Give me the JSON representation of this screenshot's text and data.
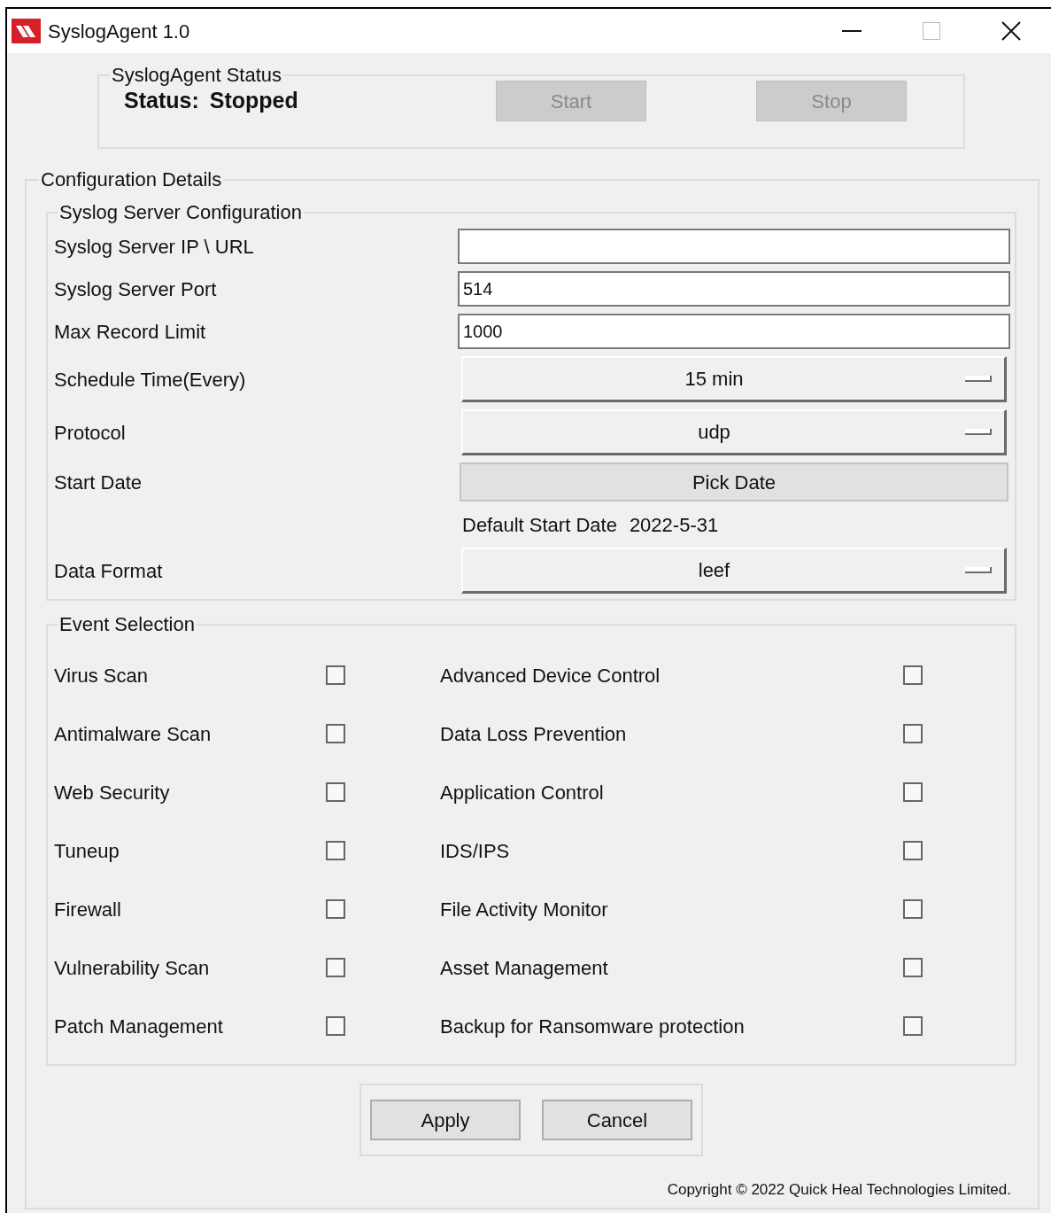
{
  "window": {
    "title": "SyslogAgent 1.0"
  },
  "status_group": {
    "title": "SyslogAgent Status",
    "status_label": "Status:",
    "status_value": "Stopped",
    "buttons": [
      {
        "label": "Start",
        "disabled": true
      },
      {
        "label": "Stop",
        "disabled": true
      }
    ]
  },
  "configuration": {
    "title": "Configuration Details",
    "server": {
      "title": "Syslog Server Configuration",
      "fields": [
        {
          "kind": "text",
          "label": "Syslog Server IP \\ URL"
        },
        {
          "kind": "text",
          "label": "Syslog Server Port",
          "value": "514"
        },
        {
          "kind": "text",
          "label": "Max Record Limit",
          "value": "1000"
        },
        {
          "kind": "dropdown",
          "label": "Schedule Time(Every)",
          "value": "15 min"
        },
        {
          "kind": "dropdown",
          "label": "Protocol",
          "value": "udp"
        },
        {
          "kind": "button",
          "label": "Start Date",
          "button": "Pick Date",
          "note_label": "Default Start Date",
          "note_value": "2022-5-31"
        },
        {
          "kind": "dropdown",
          "label": "Data Format",
          "value": "leef"
        }
      ]
    },
    "events": {
      "title": "Event Selection",
      "items": [
        {
          "label": "Virus Scan",
          "checked": false
        },
        {
          "label": "Advanced Device Control",
          "checked": false
        },
        {
          "label": "Antimalware Scan",
          "checked": false
        },
        {
          "label": "Data Loss Prevention",
          "checked": false
        },
        {
          "label": "Web Security",
          "checked": false
        },
        {
          "label": "Application Control",
          "checked": false
        },
        {
          "label": "Tuneup",
          "checked": false
        },
        {
          "label": "IDS/IPS",
          "checked": false
        },
        {
          "label": "Firewall",
          "checked": false
        },
        {
          "label": "File Activity Monitor",
          "checked": false
        },
        {
          "label": "Vulnerability Scan",
          "checked": false
        },
        {
          "label": "Asset Management",
          "checked": false
        },
        {
          "label": "Patch Management",
          "checked": false
        },
        {
          "label": "Backup for Ransomware protection",
          "checked": false
        }
      ]
    },
    "actions": [
      "Apply",
      "Cancel"
    ],
    "copyright": "Copyright © 2022 Quick Heal Technologies Limited."
  }
}
